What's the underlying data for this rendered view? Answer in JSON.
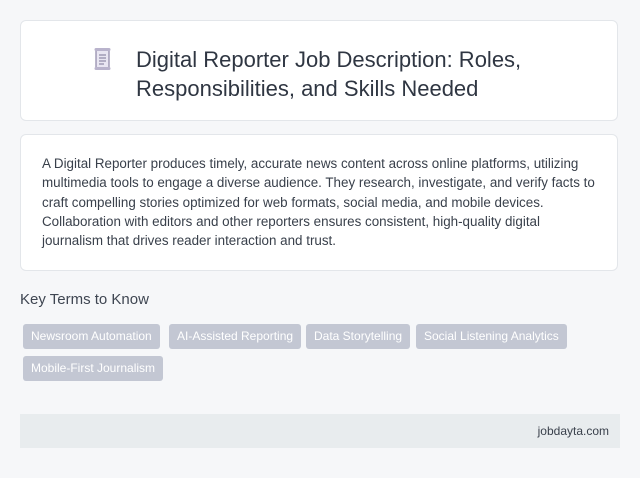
{
  "header": {
    "icon": "document-scroll-icon",
    "title": "Digital Reporter Job Description: Roles, Responsibilities, and Skills Needed"
  },
  "description": {
    "text": "A Digital Reporter produces timely, accurate news content across online platforms, utilizing multimedia tools to engage a diverse audience. They research, investigate, and verify facts to craft compelling stories optimized for web formats, social media, and mobile devices. Collaboration with editors and other reporters ensures consistent, high-quality digital journalism that drives reader interaction and trust."
  },
  "key_terms": {
    "heading": "Key Terms to Know",
    "tags": [
      "Newsroom Automation",
      "AI-Assisted Reporting",
      "Data Storytelling",
      "Social Listening Analytics",
      "Mobile-First Journalism"
    ]
  },
  "footer": {
    "site": "jobdayta.com"
  },
  "colors": {
    "tag_background": "#c3c7d3",
    "footer_background": "#e8ecee",
    "page_background": "#f6f7f9"
  }
}
